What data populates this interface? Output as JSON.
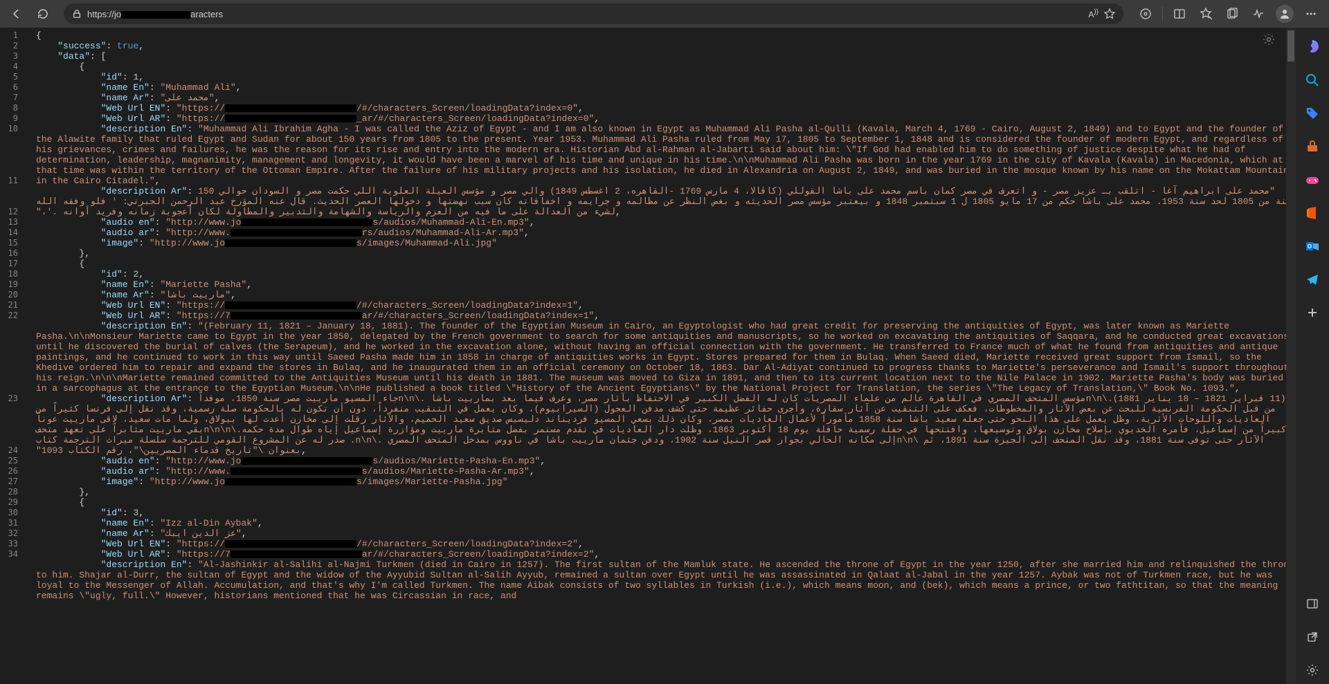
{
  "url": {
    "prefix": "https://jo",
    "suffix": "aracters"
  },
  "lines": [
    1,
    2,
    3,
    4,
    5,
    6,
    7,
    8,
    9,
    10,
    11,
    12,
    13,
    14,
    15,
    16,
    17,
    18,
    19,
    20,
    21,
    22,
    23,
    24,
    25,
    26,
    27,
    28,
    29,
    30,
    31,
    32,
    33,
    34
  ],
  "json": {
    "l1": "{",
    "l2_a": "\"success\"",
    "l2_b": ": ",
    "l2_c": "true",
    "l2_d": ",",
    "l3_a": "\"data\"",
    "l3_b": ": [",
    "l4": "{",
    "l5_a": "\"id\"",
    "l5_b": ": ",
    "l5_c": "1",
    "l5_d": ",",
    "l6_a": "\"name En\"",
    "l6_b": ": ",
    "l6_c": "\"Muhammad Ali\"",
    "l6_d": ",",
    "l7_a": "\"name Ar\"",
    "l7_b": ": ",
    "l7_c": "\"محمد على\"",
    "l7_d": ",",
    "l8_a": "\"Web Url EN\"",
    "l8_b": ": ",
    "l8_c": "\"https://",
    "l8_d": "/#/characters_Screen/loadingData?index=0\"",
    "l8_e": ",",
    "l9_a": "\"Web Url AR\"",
    "l9_b": ": ",
    "l9_c": "\"https://",
    "l9_d": "_ar/#/characters_Screen/loadingData?index=0\"",
    "l9_e": ",",
    "l10_a": "\"description En\"",
    "l10_b": ": ",
    "l10_c": "\"Muhammad Ali Ibrahim Agha - I was called the Aziz of Egypt - and I am also known in Egypt as Muhammad Ali Pasha al-Qulli (Kavala, March 4, 1769 - Cairo, August 2, 1849) and to Egypt and the founder of the Alawite family that ruled Egypt and Sudan for about 150 years from 1805 to the present. Year 1953. Muhammad Ali Pasha ruled from May 17, 1805 to September 1, 1848 and is considered the founder of modern Egypt, and regardless of his grievances, crimes and failures, he was the reason for its rise and entry into the modern era. Historian Abd al-Rahman al-Jabarti said about him: \\\"If God had enabled him to do something of justice despite what he had of determination, leadership, magnanimity, management and longevity, it would have been a marvel of his time and unique in his time.\\n\\nMuhammad Ali Pasha was born in the year 1769 in the city of Kavala (Kavala) in Macedonia, which at that time was within the territory of the Ottoman Empire. After the failure of his military projects and his isolation, he died in Alexandria on August 2, 1849, and was buried in the mosque known by his name on the Mokattam Mountain in the Cairo Citadel.\"",
    "l10_d": ",",
    "l11_a": "\"description Ar\"",
    "l11_b": ": ",
    "l11_c": "\"محمد على ابراهيم آغا - اتلقب بـ عزيز مصر - و اتعرف في مصر كمان باسم محمد على باشا القوللي (كاڤالا، 4 مارس 1769 -القاهره، 2 اغسطس 1849) والي مصر و مؤسس العيلة العلوية اللي حكمت مصر و السودان حوالي 150 سنة من 1805 لحد سنة 1953. محمد على باشا حكم من 17 مايو 1805 ل 1 سبتمبر 1848 و بيعتبر مؤسس مصر الحديثه و بغض النظر عن مظالمه و جرايمه و اخفاقاته كان سبب نهضتها و دخولها العصر الحديث. قال عنه المؤرخ عبد الرحمن الجبرتي: ' فلو وفقه الله لشيء من العدالة على ما فيه من العزم والرياسة والشهامة والتدبير والمطاولة لكان أعجوبة زمانه وفريد أوانه .'،\"",
    "l11_d": ",",
    "l12_a": "\"audio en\"",
    "l12_b": ": ",
    "l12_c": "\"http://www.jo",
    "l12_d": "s/audios/Muhammad-Ali-En.mp3\"",
    "l12_e": ",",
    "l13_a": "\"audio ar\"",
    "l13_b": ": ",
    "l13_c": "\"http://www.",
    "l13_d": "rs/audios/Muhammad-Ali-Ar.mp3\"",
    "l13_e": ",",
    "l14_a": "\"image\"",
    "l14_b": ": ",
    "l14_c": "\"http://www.jo",
    "l14_d": "s/images/Muhammad-Ali.jpg\"",
    "l15": "},",
    "l16": "{",
    "l17_a": "\"id\"",
    "l17_b": ": ",
    "l17_c": "2",
    "l17_d": ",",
    "l18_a": "\"name En\"",
    "l18_b": ": ",
    "l18_c": "\"Mariette Pasha\"",
    "l18_d": ",",
    "l19_a": "\"name Ar\"",
    "l19_b": ": ",
    "l19_c": "\"مارييت باشا\"",
    "l19_d": ",",
    "l20_a": "\"Web Url EN\"",
    "l20_b": ": ",
    "l20_c": "\"https://",
    "l20_d": "/#/characters_Screen/loadingData?index=1\"",
    "l20_e": ",",
    "l21_a": "\"Web Url AR\"",
    "l21_b": ": ",
    "l21_c": "\"https://7",
    "l21_d": "ar/#/characters_Screen/loadingData?index=1\"",
    "l21_e": ",",
    "l22_a": "\"description En\"",
    "l22_b": ": ",
    "l22_c": "\"(February 11, 1821 – January 18, 1881). The founder of the Egyptian Museum in Cairo, an Egyptologist who had great credit for preserving the antiquities of Egypt, was later known as Mariette Pasha.\\n\\nMonsieur Mariette came to Egypt in the year 1850, delegated by the French government to search for some antiquities and manuscripts, so he worked on excavating the antiquities of Saqqara, and he conducted great excavations until he discovered the burial of calves (the Serapeum), and he worked in the excavation alone, without having an official connection with the government. He transferred to France much of what he found from antiquities and antique paintings, and he continued to work in this way until Saeed Pasha made him in 1858 in charge of antiquities works in Egypt. Stores prepared for them in Bulaq. When Saeed died, Mariette received great support from Ismail, so the Khedive ordered him to repair and expand the stores in Bulaq, and he inaugurated them in an official ceremony on October 18, 1863. Dar Al-Adiyat continued to progress thanks to Mariette's perseverance and Ismail's support throughout his reign.\\n\\n\\nMariette remained committed to the Antiquities Museum until his death in 1881. The museum was moved to Giza in 1891, and then to its current location next to the Nile Palace in 1902. Mariette Pasha's body was buried in a sarcophagus at the entrance to the Egyptian Museum.\\n\\nHe published a book titled \\\"History of the Ancient Egyptians\\\" by the National Project for Translation, the series \\\"The Legacy of Translation,\\\" Book No. 1093.\"",
    "l22_d": ",",
    "l23_a": "\"description Ar\"",
    "l23_b": ": ",
    "l23_c": "\"(11 فبراير 1821 – 18 يناير 1881).\\n\\nمؤسس المتحف المصري في القاهرة عالم من علماء المصريات كان له الفضل الكبير في الاحتفاظ بآثار مصر، وعرف فيما بعد بمارييت باشا .\\n\\nجاء المسيو مارييت مصر سنة 1850، موفداً من قبل الحكومة الفرنسية للبحث عن بعض الآثار والمخطوطات، فعكف على التنقيب عن آثار سقارة، وأجرى حفائر عظيمة حتى كشف مدفن العجول (السيرابيوم)، وكان يعمل في التنقيب منفرداً، دون أن تكون له بالحكومة صلة رسمية، وقد نقل إلى فرنسا كثيراً من العاديات واللوحات الأثرية، وظل يعمل على هذا النحو حتى جعله سعيد باشا سنة 1858 مأموراً لأعمال العاديات بمصر، وكان ذلك بسعي المسيو فرديناند دليسبس صديق سعيد الحميم، والآثار رقلت إلى مخازن أعدت لها ببولاق، ولما مات سعيد، لاقى مارييت عوناً كبيراً من إسماعيل، فأمره الخديوي بإصلاح مخازن بولاق وتوسيعها، وافتتحها في حفلة رسمية حافلة يوم 18 أكتوبر 1863، وظلت دار العاديات في تقدم مستمر بفضل مثابرة مارييت ومؤازرة إسماعيل إياه طوال مدة حكمه.\\n\\n\\nبقي مارييت مثابراً على تعهد متحف الآثار حتى توفى سنة 1881، وقد نقل المتحف إلى الجيزة سنة 1891، ثم \\n\\nإلى مكانه الحالي بجوار قصر النيل سنة 1902، ودفن جثمان مارييت باشا في ناووس بمدخل المتحف المصري .\\n\\n. صدر له عن المشروع القومي للترجمة سلسلة ميراث الترجمة كتاب بعنوان \\\"تاريخ قدماء المصريين\\\"، رقم الكتاب 1093\"",
    "l23_d": ",",
    "l24_a": "\"audio en\"",
    "l24_b": ": ",
    "l24_c": "\"http://www.jo",
    "l24_d": "s/audios/Mariette-Pasha-En.mp3\"",
    "l24_e": ",",
    "l25_a": "\"audio ar\"",
    "l25_b": ": ",
    "l25_c": "\"http://www.",
    "l25_d": "s/audios/Mariette-Pasha-Ar.mp3\"",
    "l25_e": ",",
    "l26_a": "\"image\"",
    "l26_b": ": ",
    "l26_c": "\"http://www.jo",
    "l26_d": "s/images/Mariette-Pasha.jpg\"",
    "l27": "},",
    "l28": "{",
    "l29_a": "\"id\"",
    "l29_b": ": ",
    "l29_c": "3",
    "l29_d": ",",
    "l30_a": "\"name En\"",
    "l30_b": ": ",
    "l30_c": "\"Izz al-Din Aybak\"",
    "l30_d": ",",
    "l31_a": "\"name Ar\"",
    "l31_b": ": ",
    "l31_c": "\"عز الدين ايبك\"",
    "l31_d": ",",
    "l32_a": "\"Web Url EN\"",
    "l32_b": ": ",
    "l32_c": "\"https://",
    "l32_d": "/#/characters_Screen/loadingData?index=2\"",
    "l32_e": ",",
    "l33_a": "\"Web Url AR\"",
    "l33_b": ": ",
    "l33_c": "\"https://7",
    "l33_d": "ar/#/characters_Screen/loadingData?index=2\"",
    "l33_e": ",",
    "l34_a": "\"description En\"",
    "l34_b": ": ",
    "l34_c": "\"Al-Jashinkir al-Salihi al-Najmi Turkmen (died in Cairo in 1257). The first sultan of the Mamluk state. He ascended the throne of Egypt in the year 1250, after she married him and relinquished the throne to him. Shajar al-Durr, the sultan of Egypt and the widow of the Ayyubid Sultan al-Salih Ayyub, remained a sultan over Egypt until he was assassinated in Qalaat al-Jabal in the year 1257. Aybak was not of Turkmen race, but he was loyal to the Messenger of Allah. Accumulation, and that's why I'm called Turkmen. The name Aibak consists of two syllables in Turkish (i.e.), which means moon, and (bek), which means a prince, or two fathtitan, so that the meaning remains \\\"ugly, full.\\\" However, historians mentioned that he was Circassian in race, and"
  }
}
